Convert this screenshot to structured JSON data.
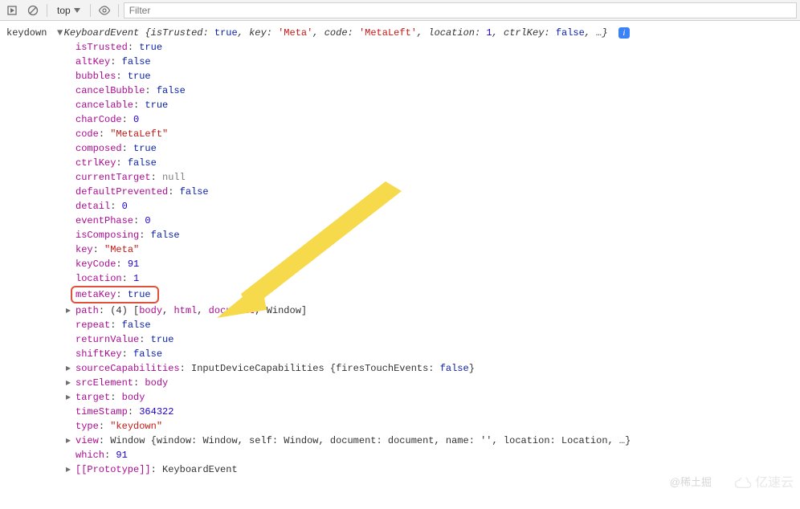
{
  "toolbar": {
    "context_label": "top",
    "filter_placeholder": "Filter"
  },
  "event_name": "keydown",
  "summary": {
    "class": "KeyboardEvent",
    "body": "{isTrusted: true, key: 'Meta', code: 'MetaLeft', location: 1, ctrlKey: false, …}"
  },
  "summary_parts": {
    "open": "{",
    "p1k": "isTrusted:",
    "p1v": "true",
    "c1": ", ",
    "p2k": "key:",
    "p2v": "'Meta'",
    "c2": ", ",
    "p3k": "code:",
    "p3v": "'MetaLeft'",
    "c3": ", ",
    "p4k": "location:",
    "p4v": "1",
    "c4": ", ",
    "p5k": "ctrlKey:",
    "p5v": "false",
    "c5": ", …}"
  },
  "p": {
    "isTrusted": {
      "k": "isTrusted",
      "v": "true",
      "t": "bool"
    },
    "altKey": {
      "k": "altKey",
      "v": "false",
      "t": "bool"
    },
    "bubbles": {
      "k": "bubbles",
      "v": "true",
      "t": "bool"
    },
    "cancelBubble": {
      "k": "cancelBubble",
      "v": "false",
      "t": "bool"
    },
    "cancelable": {
      "k": "cancelable",
      "v": "true",
      "t": "bool"
    },
    "charCode": {
      "k": "charCode",
      "v": "0",
      "t": "num"
    },
    "code": {
      "k": "code",
      "v": "\"MetaLeft\"",
      "t": "str"
    },
    "composed": {
      "k": "composed",
      "v": "true",
      "t": "bool"
    },
    "ctrlKey": {
      "k": "ctrlKey",
      "v": "false",
      "t": "bool"
    },
    "currentTarget": {
      "k": "currentTarget",
      "v": "null",
      "t": "nullv"
    },
    "defaultPrevented": {
      "k": "defaultPrevented",
      "v": "false",
      "t": "bool"
    },
    "detail": {
      "k": "detail",
      "v": "0",
      "t": "num"
    },
    "eventPhase": {
      "k": "eventPhase",
      "v": "0",
      "t": "num"
    },
    "isComposing": {
      "k": "isComposing",
      "v": "false",
      "t": "bool"
    },
    "key": {
      "k": "key",
      "v": "\"Meta\"",
      "t": "str"
    },
    "keyCode": {
      "k": "keyCode",
      "v": "91",
      "t": "num"
    },
    "location": {
      "k": "location",
      "v": "1",
      "t": "num"
    },
    "metaKey": {
      "k": "metaKey",
      "v": "true",
      "t": "bool"
    },
    "repeat": {
      "k": "repeat",
      "v": "false",
      "t": "bool"
    },
    "returnValue": {
      "k": "returnValue",
      "v": "true",
      "t": "bool"
    },
    "shiftKey": {
      "k": "shiftKey",
      "v": "false",
      "t": "bool"
    },
    "timeStamp": {
      "k": "timeStamp",
      "v": "364322",
      "t": "num"
    },
    "type": {
      "k": "type",
      "v": "\"keydown\"",
      "t": "str"
    },
    "which": {
      "k": "which",
      "v": "91",
      "t": "num"
    }
  },
  "path": {
    "k": "path",
    "len": "(4)",
    "open": "[",
    "i0": "body",
    "s0": ", ",
    "i1": "html",
    "s1": ", ",
    "i2": "document",
    "s2": ", ",
    "i3": "Window",
    "close": "]"
  },
  "sourceCapabilities": {
    "k": "sourceCapabilities",
    "cls": "InputDeviceCapabilities",
    "body_open": " {",
    "pk": "firesTouchEvents:",
    "pv": "false",
    "body_close": "}"
  },
  "srcElement": {
    "k": "srcElement",
    "v": "body"
  },
  "target": {
    "k": "target",
    "v": "body"
  },
  "view": {
    "k": "view",
    "cls": "Window",
    "body": " {window: Window, self: Window, document: document, name: '', location: Location, …}"
  },
  "proto": {
    "k": "[[Prototype]]",
    "v": "KeyboardEvent"
  },
  "watermarks": {
    "w1": "@稀土掘",
    "w2": "亿速云"
  }
}
